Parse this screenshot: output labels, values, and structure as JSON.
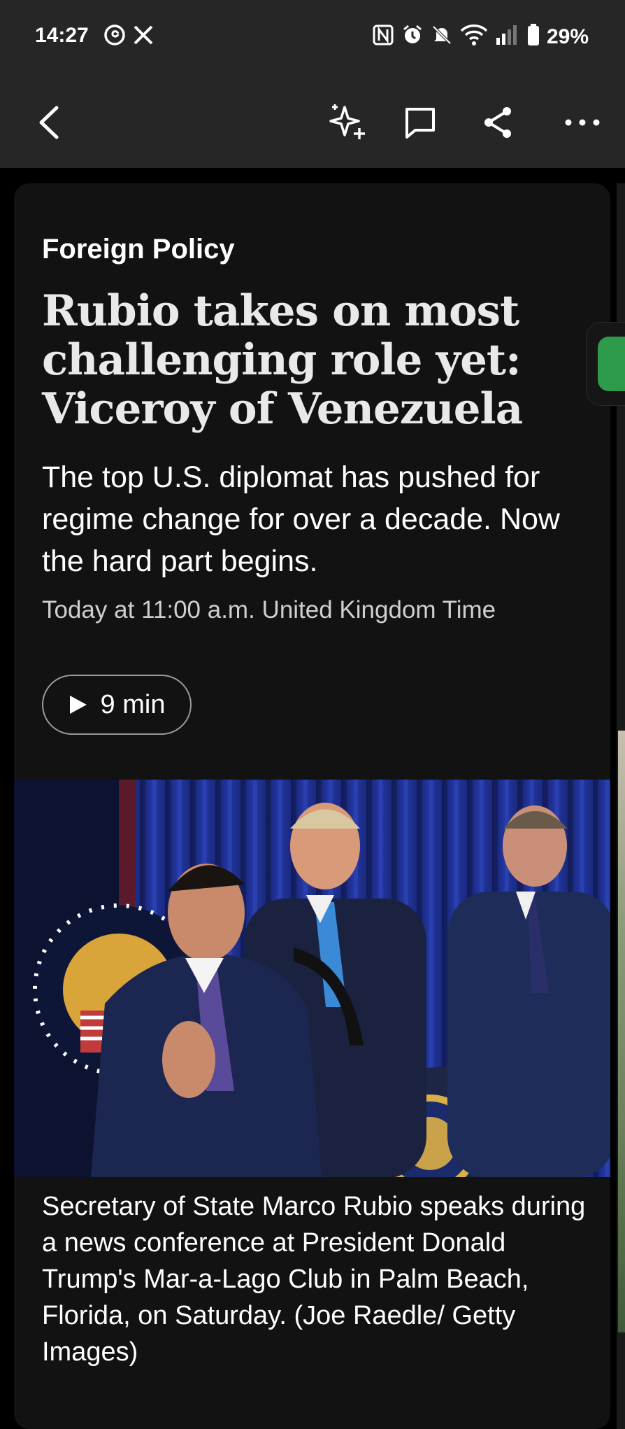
{
  "status_bar": {
    "time": "14:27",
    "battery": "29%",
    "icons": [
      "threads-icon",
      "x-icon",
      "nfc-icon",
      "alarm-icon",
      "mute-icon",
      "wifi-icon",
      "signal-icon",
      "battery-icon"
    ]
  },
  "toolbar": {
    "back": "back-icon",
    "actions": [
      "sparkle-icon",
      "comment-icon",
      "share-icon",
      "more-icon"
    ]
  },
  "article": {
    "section": "Foreign Policy",
    "headline": "Rubio takes on most challenging role yet: Viceroy of Venezuela",
    "dek": "The top U.S. diplomat has pushed for regime change for over a decade. Now the hard part begins.",
    "timestamp": "Today at 11:00 a.m. United Kingdom Time",
    "listen_label": "9 min",
    "photo_caption": "Secretary of State Marco Rubio speaks during a news conference at President Donald Trump's Mar-a-Lago Club in Palm Beach, Florida, on Saturday. (Joe Raedle/ Getty Images)"
  },
  "colors": {
    "background": "#000000",
    "bar": "#262626",
    "card": "#121212",
    "accent_green": "#2e9b4c",
    "curtain_blue": "#1f2f8a"
  }
}
